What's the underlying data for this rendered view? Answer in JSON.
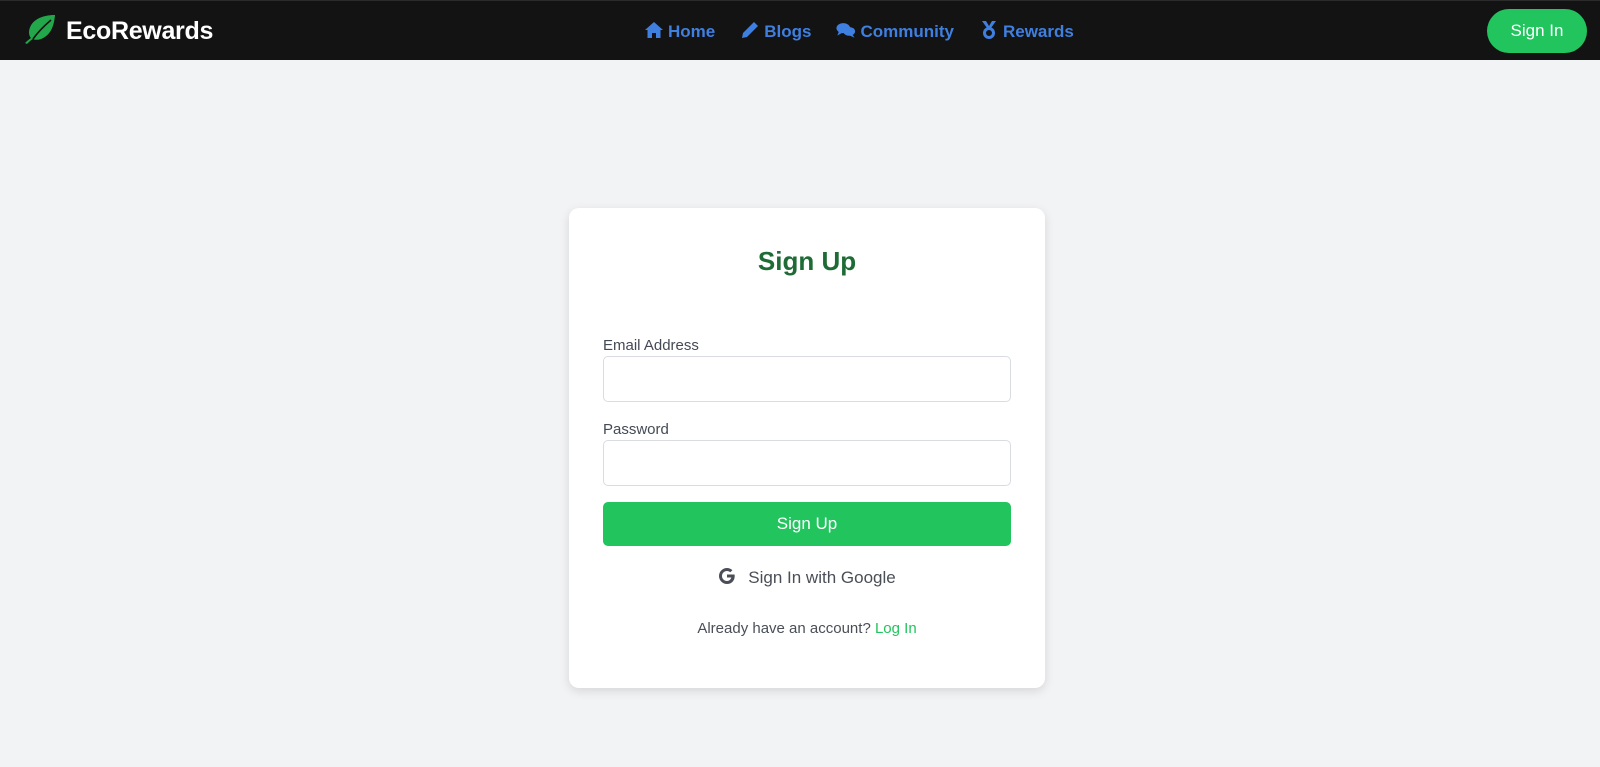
{
  "brand": {
    "name": "EcoRewards",
    "logo_icon": "leaf-icon",
    "logo_color": "#22a84a"
  },
  "nav": {
    "items": [
      {
        "label": "Home",
        "icon": "home-icon"
      },
      {
        "label": "Blogs",
        "icon": "pencil-icon"
      },
      {
        "label": "Community",
        "icon": "comments-icon"
      },
      {
        "label": "Rewards",
        "icon": "medal-icon"
      }
    ],
    "link_color": "#3f7fe0"
  },
  "header": {
    "sign_in_label": "Sign In"
  },
  "form": {
    "title": "Sign Up",
    "email_label": "Email Address",
    "email_value": "",
    "password_label": "Password",
    "password_value": "",
    "submit_label": "Sign Up",
    "google_label": "Sign In with Google",
    "google_icon": "google-icon",
    "login_prompt": "Already have an account?",
    "login_link": "Log In"
  },
  "colors": {
    "accent": "#22c45e",
    "title": "#1f6b35",
    "navbar_bg": "#131313",
    "page_bg": "#f2f3f5"
  }
}
